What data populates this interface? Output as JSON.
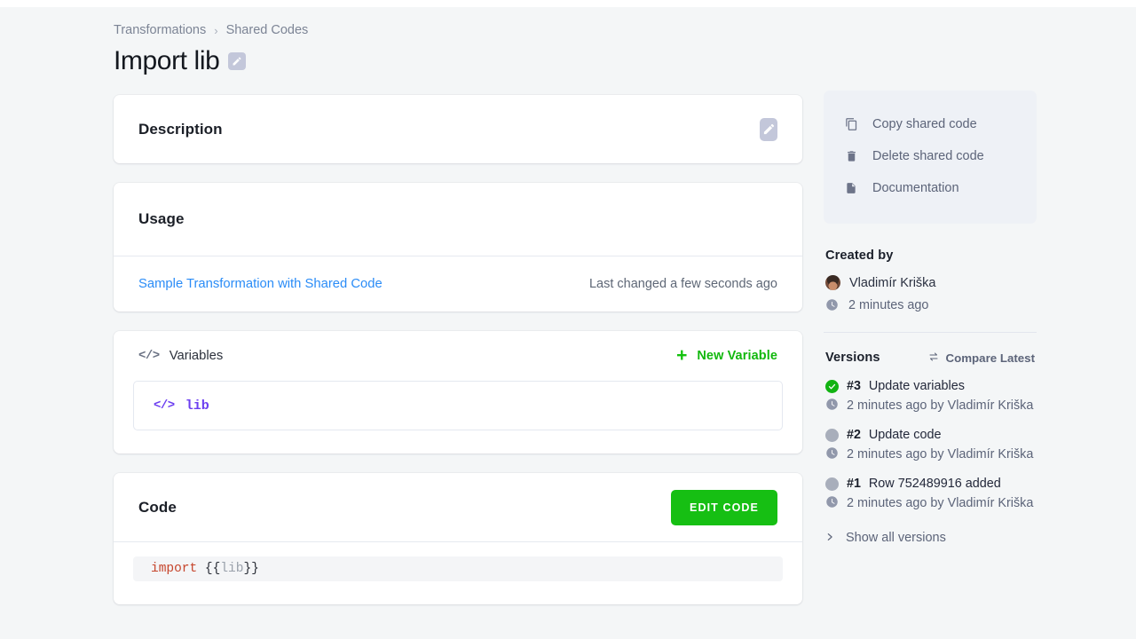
{
  "breadcrumb": {
    "items": [
      "Transformations",
      "Shared Codes"
    ],
    "separator": "›"
  },
  "header": {
    "title": "Import lib",
    "edit_icon": "pencil-icon"
  },
  "description_card": {
    "title": "Description",
    "edit_icon": "pencil-icon"
  },
  "usage_card": {
    "title": "Usage",
    "rows": [
      {
        "link": "Sample Transformation with Shared Code",
        "meta": "Last changed a few seconds ago"
      }
    ]
  },
  "variables_card": {
    "title": "Variables",
    "title_icon": "code-brackets-icon",
    "new_variable_label": "New Variable",
    "new_variable_icon": "plus-icon",
    "variables": [
      {
        "icon": "code-brackets-icon",
        "name": "lib"
      }
    ]
  },
  "code_card": {
    "title": "Code",
    "edit_button_label": "EDIT CODE",
    "code_tokens": [
      {
        "text": "import",
        "type": "keyword"
      },
      {
        "text": " ",
        "type": "plain"
      },
      {
        "text": "{{",
        "type": "brace"
      },
      {
        "text": "lib",
        "type": "variable"
      },
      {
        "text": "}}",
        "type": "brace"
      }
    ]
  },
  "sidebar": {
    "actions": [
      {
        "label": "Copy shared code",
        "icon": "copy-icon"
      },
      {
        "label": "Delete shared code",
        "icon": "trash-icon"
      },
      {
        "label": "Documentation",
        "icon": "document-icon"
      }
    ],
    "created_by": {
      "title": "Created by",
      "user": "Vladimír Kriška",
      "time": "2 minutes ago",
      "avatar": "user-avatar",
      "time_icon": "clock-icon"
    },
    "versions": {
      "title": "Versions",
      "compare_label": "Compare Latest",
      "compare_icon": "swap-arrows-icon",
      "items": [
        {
          "number": "#3",
          "description": "Update variables",
          "meta": "2 minutes ago by Vladimír Kriška",
          "status": "current",
          "status_icon": "check-circle-icon",
          "time_icon": "clock-icon"
        },
        {
          "number": "#2",
          "description": "Update code",
          "meta": "2 minutes ago by Vladimír Kriška",
          "status": "past",
          "status_icon": "dot-icon",
          "time_icon": "clock-icon"
        },
        {
          "number": "#1",
          "description": "Row 752489916 added",
          "meta": "2 minutes ago by Vladimír Kriška",
          "status": "past",
          "status_icon": "dot-icon",
          "time_icon": "clock-icon"
        }
      ],
      "show_all_label": "Show all versions",
      "show_all_icon": "chevron-right-icon"
    }
  },
  "colors": {
    "accent_green": "#16bf13",
    "link_blue": "#2a8cf7",
    "variable_purple": "#6c3ff0",
    "page_background": "#f4f6f7",
    "muted_text": "#5c6479"
  }
}
